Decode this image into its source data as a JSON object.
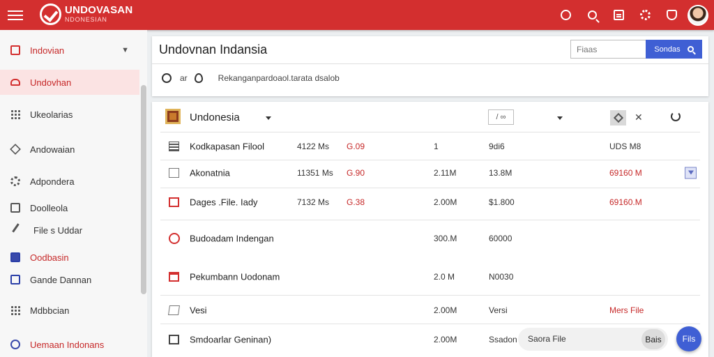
{
  "header": {
    "brand_name": "UNDOVASAN",
    "brand_sub": "NDONESIAN",
    "icons": [
      "help-icon",
      "search-icon",
      "document-icon",
      "settings-icon",
      "shield-icon"
    ]
  },
  "sidebar": {
    "items": [
      {
        "label": "Indovian",
        "icon": "grid-icon"
      },
      {
        "label": "Undovhan",
        "icon": "car-icon"
      },
      {
        "label": "Ukeolarias",
        "icon": "apps-icon"
      },
      {
        "label": "Andowaian",
        "icon": "diamond-icon"
      },
      {
        "label": "Adpondera",
        "icon": "gear-icon"
      },
      {
        "label": "Doolleola",
        "icon": "box-icon"
      },
      {
        "label": "File s Uddar",
        "icon": "pen-icon"
      },
      {
        "label": "Oodbasin",
        "icon": "chat-icon"
      },
      {
        "label": "Gande Dannan",
        "icon": "user-icon"
      },
      {
        "label": "Mdbbcian",
        "icon": "grid-icon"
      },
      {
        "label": "Uemaan Indonans",
        "icon": "dot-icon"
      }
    ]
  },
  "main": {
    "title": "Undovnan Indansia",
    "search_placeholder": "Fiaas",
    "search_button": "Sondas",
    "subbar_label": "ar",
    "subbar_text": "Rekanganpardoaol.tarata dsalob"
  },
  "table": {
    "header_title": "Undonesia",
    "filter_label": "/",
    "rows": [
      {
        "name": "Kodkapasan Filool",
        "c1": "4122 Ms",
        "c2": "G.09",
        "c3": "1",
        "c4": "9di6",
        "c5": "UDS M8",
        "icon": "table-icon"
      },
      {
        "name": "Akonatnia",
        "c1": "11351 Ms",
        "c2": "G.90",
        "c3": "2.11M",
        "c4": "13.8M",
        "c5": "69160 M",
        "icon": "file-icon"
      },
      {
        "name": "Dages .File. Iady",
        "c1": "7132 Ms",
        "c2": "G.38",
        "c3": "2.00M",
        "c4": "$1.800",
        "c5": "69160.M",
        "icon": "square-icon"
      },
      {
        "name": "Budoadam Indengan",
        "c1": "",
        "c2": "",
        "c3": "300.M",
        "c4": "60000",
        "c5": "",
        "icon": "clock-icon"
      },
      {
        "name": "Pekumbann Uodonam",
        "c1": "",
        "c2": "",
        "c3": "2.0 M",
        "c4": "N0030",
        "c5": "",
        "icon": "calendar-icon"
      },
      {
        "name": "Vesi",
        "c1": "",
        "c2": "",
        "c3": "2.00M",
        "c4": "Versi",
        "c5": "Mers File",
        "icon": "document-icon"
      },
      {
        "name": "Smdoarlar Geninan)",
        "c1": "",
        "c2": "",
        "c3": "2.00M",
        "c4": "Ssadon",
        "c5": "",
        "icon": "cube-icon"
      }
    ],
    "footer_placeholder": "Saora File",
    "footer_btn": "Bais",
    "fab_label": "Fils"
  }
}
